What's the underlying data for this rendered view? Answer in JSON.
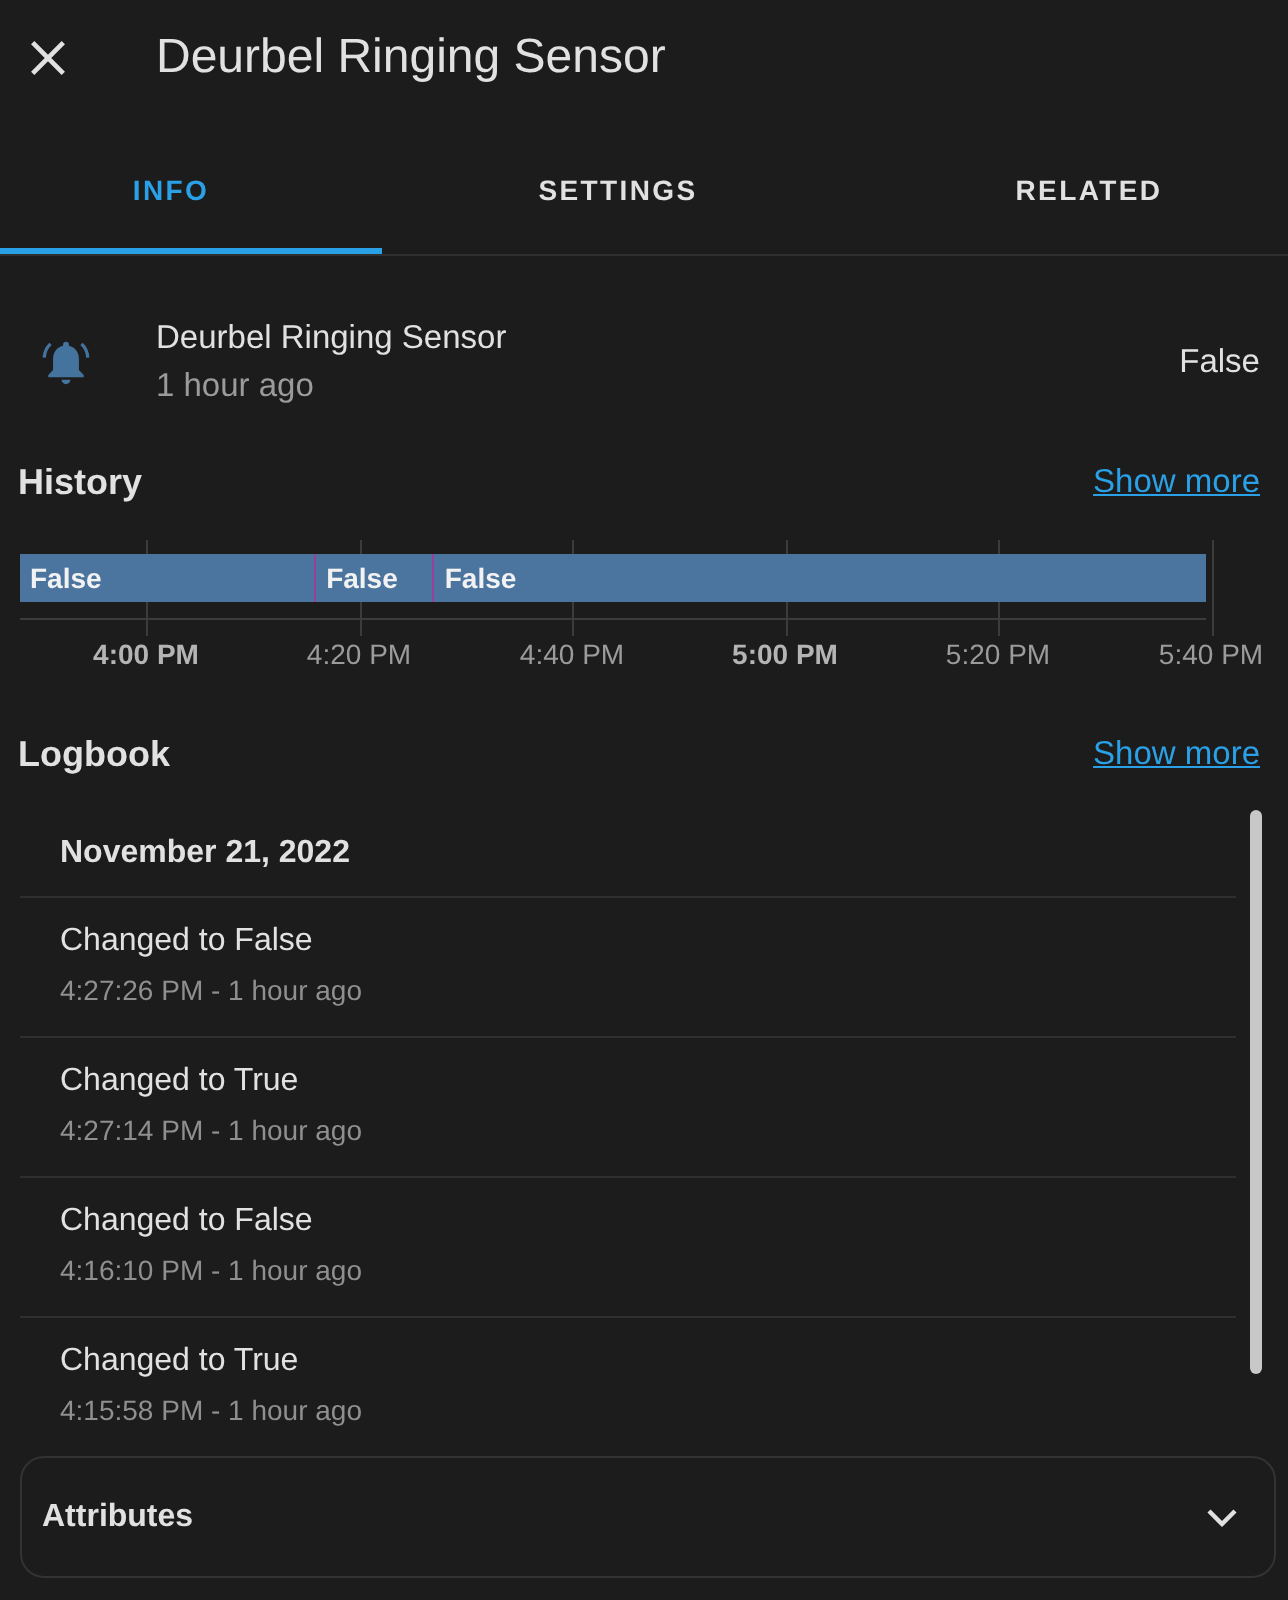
{
  "header": {
    "title": "Deurbel Ringing Sensor"
  },
  "tabs": [
    {
      "label": "INFO",
      "selected": true
    },
    {
      "label": "SETTINGS",
      "selected": false
    },
    {
      "label": "RELATED",
      "selected": false
    }
  ],
  "entity": {
    "name": "Deurbel Ringing Sensor",
    "last_changed": "1 hour ago",
    "state": "False"
  },
  "history": {
    "title": "History",
    "link": "Show more",
    "segments": [
      {
        "label": "False"
      },
      {
        "label": "False"
      },
      {
        "label": "False"
      }
    ],
    "ticks": [
      {
        "label": "4:00 PM",
        "bold": true
      },
      {
        "label": "4:20 PM",
        "bold": false
      },
      {
        "label": "4:40 PM",
        "bold": false
      },
      {
        "label": "5:00 PM",
        "bold": true
      },
      {
        "label": "5:20 PM",
        "bold": false
      },
      {
        "label": "5:40 PM",
        "bold": false
      }
    ]
  },
  "logbook": {
    "title": "Logbook",
    "link": "Show more",
    "date": "November 21, 2022",
    "entries": [
      {
        "message": "Changed to False",
        "time": "4:27:26 PM - 1 hour ago"
      },
      {
        "message": "Changed to True",
        "time": "4:27:14 PM - 1 hour ago"
      },
      {
        "message": "Changed to False",
        "time": "4:16:10 PM - 1 hour ago"
      },
      {
        "message": "Changed to True",
        "time": "4:15:58 PM - 1 hour ago"
      }
    ]
  },
  "attributes": {
    "title": "Attributes",
    "expanded": false
  }
}
